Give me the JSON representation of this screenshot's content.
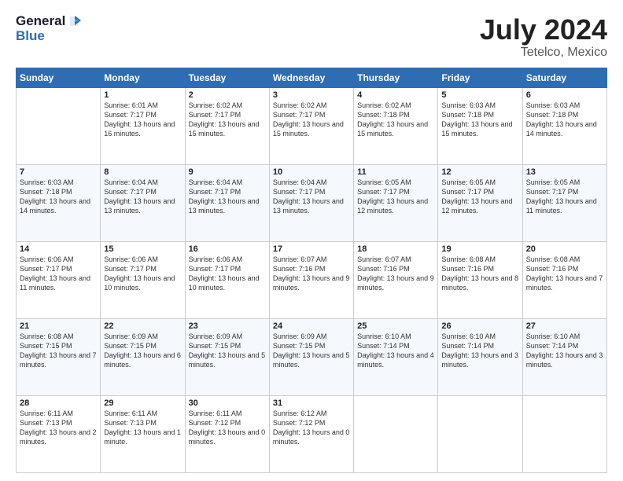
{
  "logo": {
    "line1": "General",
    "line2": "Blue"
  },
  "title": "July 2024",
  "subtitle": "Tetelco, Mexico",
  "days_of_week": [
    "Sunday",
    "Monday",
    "Tuesday",
    "Wednesday",
    "Thursday",
    "Friday",
    "Saturday"
  ],
  "weeks": [
    [
      {
        "day": "",
        "sunrise": "",
        "sunset": "",
        "daylight": ""
      },
      {
        "day": "1",
        "sunrise": "Sunrise: 6:01 AM",
        "sunset": "Sunset: 7:17 PM",
        "daylight": "Daylight: 13 hours and 16 minutes."
      },
      {
        "day": "2",
        "sunrise": "Sunrise: 6:02 AM",
        "sunset": "Sunset: 7:17 PM",
        "daylight": "Daylight: 13 hours and 15 minutes."
      },
      {
        "day": "3",
        "sunrise": "Sunrise: 6:02 AM",
        "sunset": "Sunset: 7:17 PM",
        "daylight": "Daylight: 13 hours and 15 minutes."
      },
      {
        "day": "4",
        "sunrise": "Sunrise: 6:02 AM",
        "sunset": "Sunset: 7:18 PM",
        "daylight": "Daylight: 13 hours and 15 minutes."
      },
      {
        "day": "5",
        "sunrise": "Sunrise: 6:03 AM",
        "sunset": "Sunset: 7:18 PM",
        "daylight": "Daylight: 13 hours and 15 minutes."
      },
      {
        "day": "6",
        "sunrise": "Sunrise: 6:03 AM",
        "sunset": "Sunset: 7:18 PM",
        "daylight": "Daylight: 13 hours and 14 minutes."
      }
    ],
    [
      {
        "day": "7",
        "sunrise": "Sunrise: 6:03 AM",
        "sunset": "Sunset: 7:18 PM",
        "daylight": "Daylight: 13 hours and 14 minutes."
      },
      {
        "day": "8",
        "sunrise": "Sunrise: 6:04 AM",
        "sunset": "Sunset: 7:17 PM",
        "daylight": "Daylight: 13 hours and 13 minutes."
      },
      {
        "day": "9",
        "sunrise": "Sunrise: 6:04 AM",
        "sunset": "Sunset: 7:17 PM",
        "daylight": "Daylight: 13 hours and 13 minutes."
      },
      {
        "day": "10",
        "sunrise": "Sunrise: 6:04 AM",
        "sunset": "Sunset: 7:17 PM",
        "daylight": "Daylight: 13 hours and 13 minutes."
      },
      {
        "day": "11",
        "sunrise": "Sunrise: 6:05 AM",
        "sunset": "Sunset: 7:17 PM",
        "daylight": "Daylight: 13 hours and 12 minutes."
      },
      {
        "day": "12",
        "sunrise": "Sunrise: 6:05 AM",
        "sunset": "Sunset: 7:17 PM",
        "daylight": "Daylight: 13 hours and 12 minutes."
      },
      {
        "day": "13",
        "sunrise": "Sunrise: 6:05 AM",
        "sunset": "Sunset: 7:17 PM",
        "daylight": "Daylight: 13 hours and 11 minutes."
      }
    ],
    [
      {
        "day": "14",
        "sunrise": "Sunrise: 6:06 AM",
        "sunset": "Sunset: 7:17 PM",
        "daylight": "Daylight: 13 hours and 11 minutes."
      },
      {
        "day": "15",
        "sunrise": "Sunrise: 6:06 AM",
        "sunset": "Sunset: 7:17 PM",
        "daylight": "Daylight: 13 hours and 10 minutes."
      },
      {
        "day": "16",
        "sunrise": "Sunrise: 6:06 AM",
        "sunset": "Sunset: 7:17 PM",
        "daylight": "Daylight: 13 hours and 10 minutes."
      },
      {
        "day": "17",
        "sunrise": "Sunrise: 6:07 AM",
        "sunset": "Sunset: 7:16 PM",
        "daylight": "Daylight: 13 hours and 9 minutes."
      },
      {
        "day": "18",
        "sunrise": "Sunrise: 6:07 AM",
        "sunset": "Sunset: 7:16 PM",
        "daylight": "Daylight: 13 hours and 9 minutes."
      },
      {
        "day": "19",
        "sunrise": "Sunrise: 6:08 AM",
        "sunset": "Sunset: 7:16 PM",
        "daylight": "Daylight: 13 hours and 8 minutes."
      },
      {
        "day": "20",
        "sunrise": "Sunrise: 6:08 AM",
        "sunset": "Sunset: 7:16 PM",
        "daylight": "Daylight: 13 hours and 7 minutes."
      }
    ],
    [
      {
        "day": "21",
        "sunrise": "Sunrise: 6:08 AM",
        "sunset": "Sunset: 7:15 PM",
        "daylight": "Daylight: 13 hours and 7 minutes."
      },
      {
        "day": "22",
        "sunrise": "Sunrise: 6:09 AM",
        "sunset": "Sunset: 7:15 PM",
        "daylight": "Daylight: 13 hours and 6 minutes."
      },
      {
        "day": "23",
        "sunrise": "Sunrise: 6:09 AM",
        "sunset": "Sunset: 7:15 PM",
        "daylight": "Daylight: 13 hours and 5 minutes."
      },
      {
        "day": "24",
        "sunrise": "Sunrise: 6:09 AM",
        "sunset": "Sunset: 7:15 PM",
        "daylight": "Daylight: 13 hours and 5 minutes."
      },
      {
        "day": "25",
        "sunrise": "Sunrise: 6:10 AM",
        "sunset": "Sunset: 7:14 PM",
        "daylight": "Daylight: 13 hours and 4 minutes."
      },
      {
        "day": "26",
        "sunrise": "Sunrise: 6:10 AM",
        "sunset": "Sunset: 7:14 PM",
        "daylight": "Daylight: 13 hours and 3 minutes."
      },
      {
        "day": "27",
        "sunrise": "Sunrise: 6:10 AM",
        "sunset": "Sunset: 7:14 PM",
        "daylight": "Daylight: 13 hours and 3 minutes."
      }
    ],
    [
      {
        "day": "28",
        "sunrise": "Sunrise: 6:11 AM",
        "sunset": "Sunset: 7:13 PM",
        "daylight": "Daylight: 13 hours and 2 minutes."
      },
      {
        "day": "29",
        "sunrise": "Sunrise: 6:11 AM",
        "sunset": "Sunset: 7:13 PM",
        "daylight": "Daylight: 13 hours and 1 minute."
      },
      {
        "day": "30",
        "sunrise": "Sunrise: 6:11 AM",
        "sunset": "Sunset: 7:12 PM",
        "daylight": "Daylight: 13 hours and 0 minutes."
      },
      {
        "day": "31",
        "sunrise": "Sunrise: 6:12 AM",
        "sunset": "Sunset: 7:12 PM",
        "daylight": "Daylight: 13 hours and 0 minutes."
      },
      {
        "day": "",
        "sunrise": "",
        "sunset": "",
        "daylight": ""
      },
      {
        "day": "",
        "sunrise": "",
        "sunset": "",
        "daylight": ""
      },
      {
        "day": "",
        "sunrise": "",
        "sunset": "",
        "daylight": ""
      }
    ]
  ]
}
